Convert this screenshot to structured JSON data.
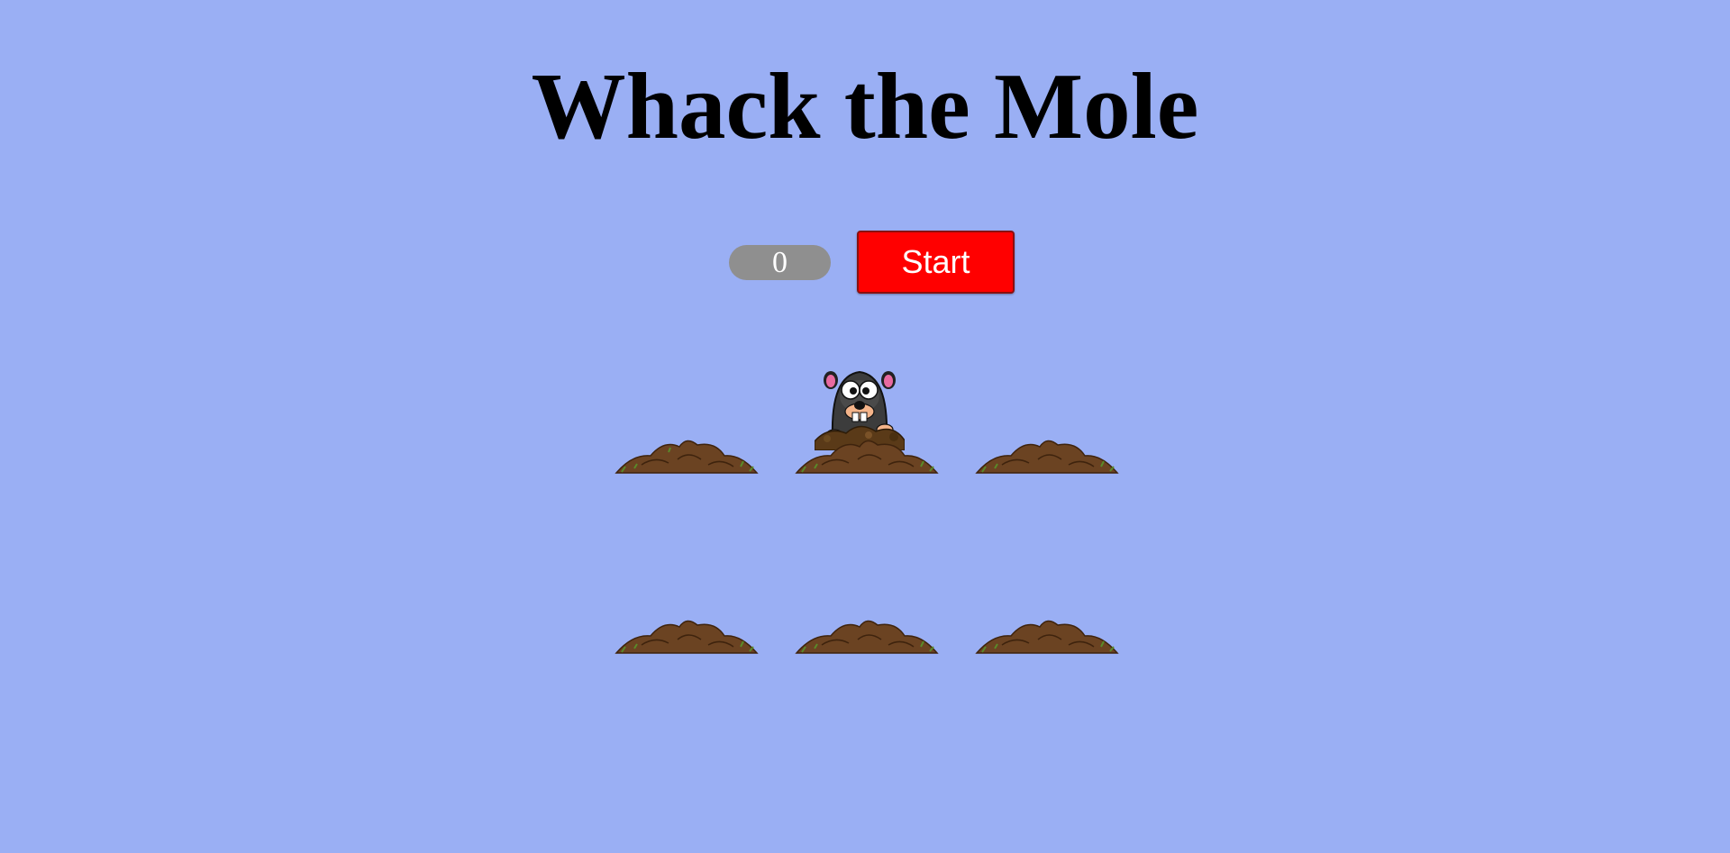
{
  "game": {
    "title": "Whack the Mole",
    "score": "0",
    "start_label": "Start"
  },
  "board": {
    "holes": [
      {
        "row": 1,
        "col": 1,
        "has_mole": false
      },
      {
        "row": 1,
        "col": 2,
        "has_mole": true
      },
      {
        "row": 1,
        "col": 3,
        "has_mole": false
      },
      {
        "row": 2,
        "col": 1,
        "has_mole": false
      },
      {
        "row": 2,
        "col": 2,
        "has_mole": false
      },
      {
        "row": 2,
        "col": 3,
        "has_mole": false
      }
    ]
  },
  "colors": {
    "background": "#9aaff4",
    "score_bg": "#8f8f8f",
    "start_button": "#ff0000",
    "dirt": "#6b4322",
    "dirt_dark": "#4a2c14",
    "grass": "#5a8a2a"
  },
  "icons": {
    "dirt_mound": "dirt-mound-icon",
    "mole": "mole-icon"
  }
}
